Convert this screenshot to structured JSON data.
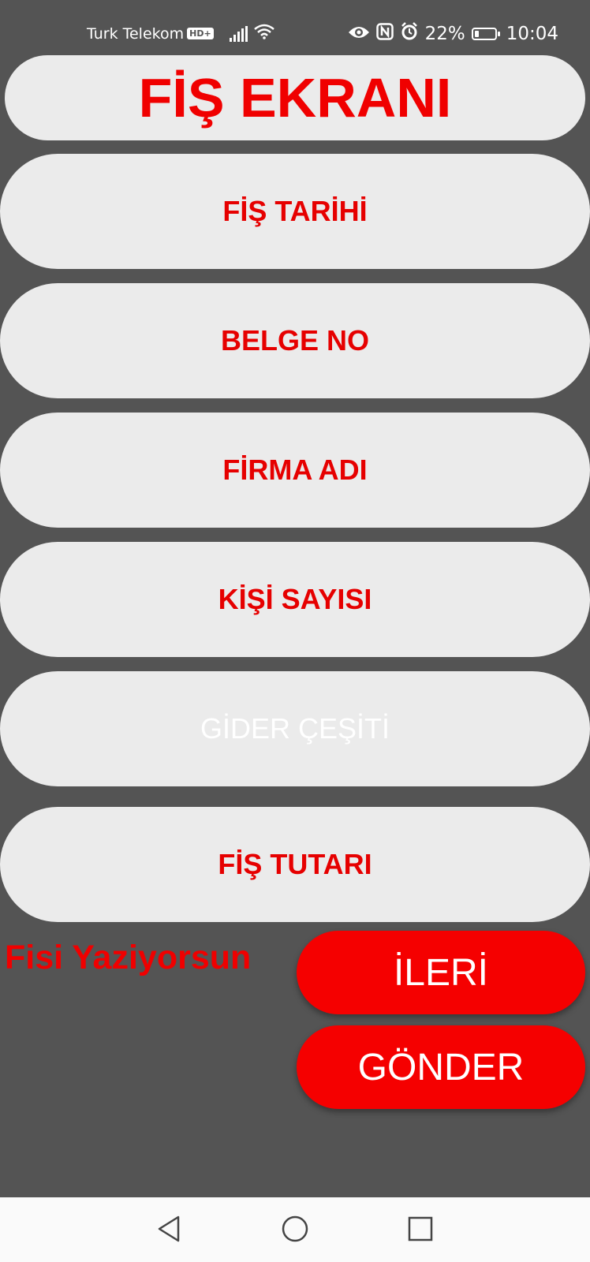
{
  "status_bar": {
    "carrier": "Turk Telekom",
    "network_badge": "HD+",
    "battery_percent": "22%",
    "battery_level": 0.22,
    "time": "10:04",
    "icons": [
      "signal-icon",
      "wifi-icon",
      "eye-icon",
      "nfc-icon",
      "alarm-icon",
      "battery-icon"
    ]
  },
  "screen_title": "FİŞ EKRANI",
  "fields": [
    {
      "label": "FİŞ TARİHİ"
    },
    {
      "label": "BELGE NO"
    },
    {
      "label": "FİRMA ADI"
    },
    {
      "label": "KİŞİ SAYISI"
    },
    {
      "label": "GİDER ÇEŞİTİ"
    },
    {
      "label": "FİŞ TUTARI"
    }
  ],
  "status_message": "Fisi Yaziyorsun",
  "buttons": {
    "next": "İLERİ",
    "send": "GÖNDER"
  },
  "nav": {
    "icons": [
      "back-icon",
      "home-icon",
      "recents-icon"
    ]
  },
  "colors": {
    "background": "#545454",
    "pill": "#ebebeb",
    "accent_red": "#f00000",
    "button_red": "#f50000",
    "hint_text": "#ffffff",
    "nav_bar": "#fafafa"
  }
}
